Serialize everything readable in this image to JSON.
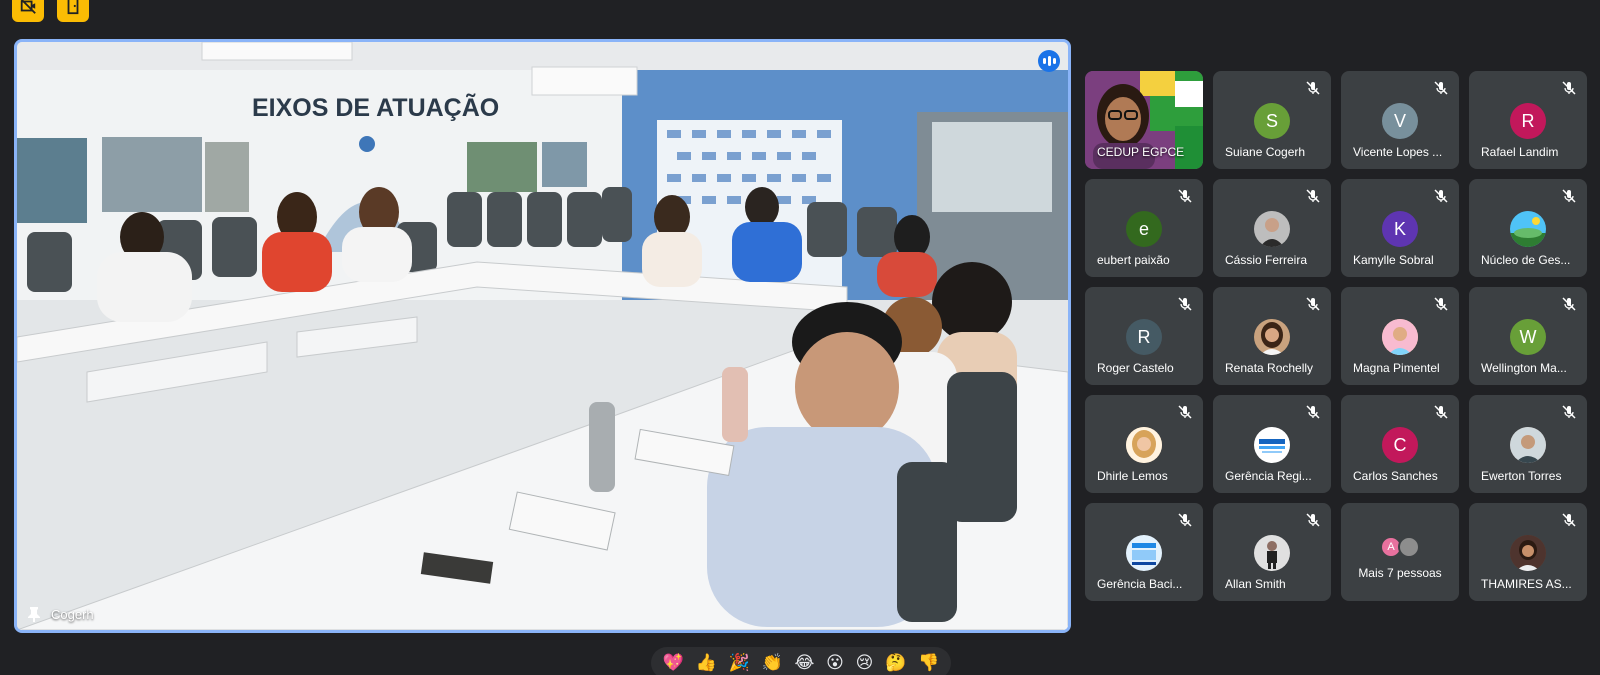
{
  "main": {
    "name": "Cogerh",
    "wall_title": "EIXOS DE ATUAÇÃO"
  },
  "participants": [
    {
      "name": "CEDUP EGPCE",
      "type": "video"
    },
    {
      "name": "Suiane Cogerh",
      "initial": "S",
      "color": "#689f38",
      "type": "letter"
    },
    {
      "name": "Vicente Lopes ...",
      "initial": "V",
      "color": "#78909c",
      "type": "letter"
    },
    {
      "name": "Rafael Landim",
      "initial": "R",
      "color": "#c2185b",
      "type": "letter"
    },
    {
      "name": "eubert paixão",
      "initial": "e",
      "color": "#33691e",
      "type": "letter"
    },
    {
      "name": "Cássio Ferreira",
      "type": "photo",
      "photo_color": "#bdbdbd"
    },
    {
      "name": "Kamylle Sobral",
      "initial": "K",
      "color": "#5e35b1",
      "type": "letter"
    },
    {
      "name": "Núcleo de Ges...",
      "type": "photo",
      "photo_color": "#4fc3f7"
    },
    {
      "name": "Roger Castelo",
      "initial": "R",
      "color": "#455a64",
      "type": "letter"
    },
    {
      "name": "Renata Rochelly",
      "type": "photo",
      "photo_color": "#c9a27e"
    },
    {
      "name": "Magna Pimentel",
      "type": "photo",
      "photo_color": "#f0c27b"
    },
    {
      "name": "Wellington Ma...",
      "initial": "W",
      "color": "#689f38",
      "type": "letter"
    },
    {
      "name": "Dhirle Lemos",
      "type": "photo",
      "photo_color": "#e0b486"
    },
    {
      "name": "Gerência Regi...",
      "type": "photo",
      "photo_color": "#ffffff"
    },
    {
      "name": "Carlos Sanches",
      "initial": "C",
      "color": "#c2185b",
      "type": "letter"
    },
    {
      "name": "Ewerton Torres",
      "type": "photo",
      "photo_color": "#8d6e63"
    },
    {
      "name": "Gerência Baci...",
      "type": "photo",
      "photo_color": "#e3f2fd"
    },
    {
      "name": "Allan Smith",
      "type": "photo",
      "photo_color": "#e0e0e0"
    },
    {
      "name": "Mais 7 pessoas",
      "initial": "A",
      "type": "more"
    },
    {
      "name": "THAMIRES AS...",
      "type": "photo",
      "photo_color": "#6d4c41"
    }
  ],
  "reactions": [
    "💖",
    "👍",
    "🎉",
    "👏",
    "😂",
    "😮",
    "😢",
    "🤔",
    "👎"
  ]
}
